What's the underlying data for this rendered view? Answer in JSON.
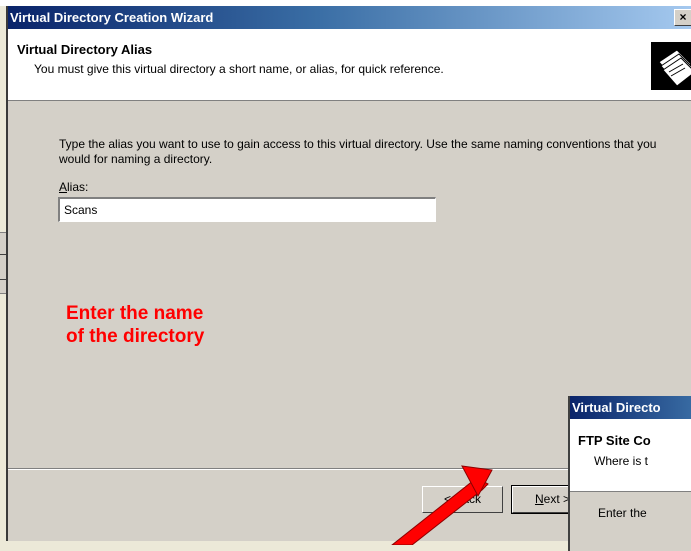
{
  "wizard": {
    "title": "Virtual Directory Creation Wizard",
    "close_label": "×",
    "header": {
      "title": "Virtual Directory Alias",
      "subtitle": "You must give this virtual directory a short name, or alias, for quick reference."
    },
    "instructions": "Type the alias you want to use to gain access to this virtual directory. Use the same naming conventions that you would for naming a directory.",
    "alias": {
      "label_first": "A",
      "label_rest": "lias:",
      "value": "Scans"
    },
    "buttons": {
      "back_prefix": "< ",
      "back_underlined": "B",
      "back_rest": "ack",
      "next_underlined": "N",
      "next_rest": "ext >"
    }
  },
  "annotation": {
    "line1": "Enter the name",
    "line2": "of the directory",
    "color": "#ff0000"
  },
  "second_wizard": {
    "title": "Virtual Directo",
    "header_title": "FTP Site Co",
    "header_sub": "Where is t",
    "body": "Enter the"
  },
  "colors": {
    "titlebar_start": "#0a246a",
    "dialog_face": "#d4d0c8",
    "header_bg": "#ffffff"
  }
}
